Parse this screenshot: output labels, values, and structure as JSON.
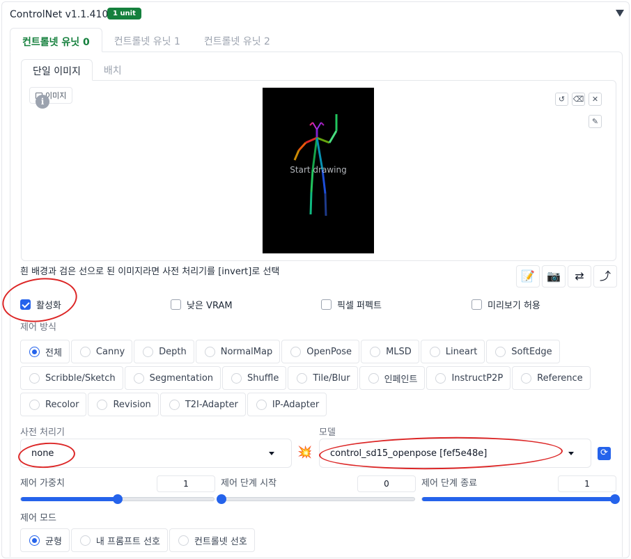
{
  "header": {
    "title": "ControlNet v1.1.410",
    "badge": "1 unit"
  },
  "tabs": [
    "컨트롤넷 유닛 0",
    "컨트롤넷 유닛 1",
    "컨트롤넷 유닛 2"
  ],
  "subtabs": [
    "단일 이미지",
    "배치"
  ],
  "image_panel": {
    "label": "이미지",
    "canvas_text": "Start drawing",
    "info_glyph": "i"
  },
  "canvas_buttons": {
    "undo": "↺",
    "erase": "⌫",
    "close": "✕",
    "brush": "✎"
  },
  "hint": "흰 배경과 검은 선으로 된 이미지라면 사전 처리기를 [invert]로 선택",
  "tool_buttons": {
    "edit": "📝",
    "camera": "📷",
    "swap": "⇄",
    "send": "⤴"
  },
  "options": [
    {
      "label": "활성화",
      "checked": true
    },
    {
      "label": "낮은 VRAM",
      "checked": false
    },
    {
      "label": "픽셀 퍼펙트",
      "checked": false
    },
    {
      "label": "미리보기 허용",
      "checked": false
    }
  ],
  "control_type": {
    "label": "제어 방식",
    "rows": [
      [
        "전체",
        "Canny",
        "Depth",
        "NormalMap",
        "OpenPose",
        "MLSD",
        "Lineart",
        "SoftEdge"
      ],
      [
        "Scribble/Sketch",
        "Segmentation",
        "Shuffle",
        "Tile/Blur",
        "인페인트",
        "InstructP2P",
        "Reference"
      ],
      [
        "Recolor",
        "Revision",
        "T2I-Adapter",
        "IP-Adapter"
      ]
    ],
    "selected": "전체"
  },
  "preprocessor": {
    "label": "사전 처리기",
    "value": "none"
  },
  "model": {
    "label": "모델",
    "value": "control_sd15_openpose [fef5e48e]",
    "explode_icon": "💥",
    "refresh_icon": "⟳"
  },
  "weight": {
    "label": "제어 가중치",
    "value": "1",
    "fraction": 0.5
  },
  "start": {
    "label": "제어 단계 시작",
    "value": "0",
    "fraction": 0.0
  },
  "end": {
    "label": "제어 단계 종료",
    "value": "1",
    "fraction": 1.0
  },
  "control_mode": {
    "label": "제어 모드",
    "options": [
      "균형",
      "내 프롬프트 선호",
      "컨트롤넷 선호"
    ],
    "selected": "균형"
  },
  "colors": {
    "accent": "#2563eb",
    "badge": "#15803d",
    "active_tab": "#15803d",
    "annotation": "#dc2626"
  }
}
